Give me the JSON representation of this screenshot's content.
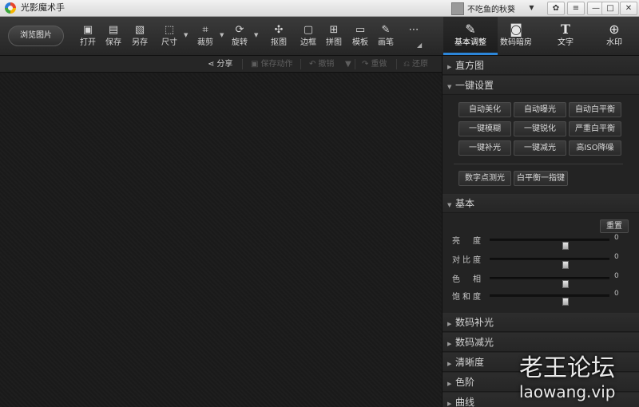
{
  "app": {
    "title": "光影魔术手"
  },
  "titlebar": {
    "user_name": "不吃鱼的秋葵",
    "buttons": [
      {
        "icon": "paw-icon",
        "glyph": "✿"
      },
      {
        "icon": "menu-icon",
        "glyph": "≡"
      },
      {
        "icon": "minimize-icon",
        "glyph": "—"
      },
      {
        "icon": "maximize-icon",
        "glyph": "□"
      },
      {
        "icon": "close-icon",
        "glyph": "✕"
      }
    ]
  },
  "toolbar": {
    "browse_label": "浏览图片",
    "tools": [
      {
        "label": "打开",
        "glyph": "▣"
      },
      {
        "label": "保存",
        "glyph": "▤"
      },
      {
        "label": "另存",
        "glyph": "▧"
      },
      {
        "label": "尺寸",
        "glyph": "⬚"
      },
      {
        "label": "裁剪",
        "glyph": "⌗"
      },
      {
        "label": "旋转",
        "glyph": "⟳"
      },
      {
        "label": "抠图",
        "glyph": "✣"
      },
      {
        "label": "边框",
        "glyph": "▢"
      },
      {
        "label": "拼图",
        "glyph": "⊞"
      },
      {
        "label": "模板",
        "glyph": "▭"
      },
      {
        "label": "画笔",
        "glyph": "✎"
      },
      {
        "label": "",
        "glyph": "⋯"
      }
    ],
    "modes": [
      {
        "label": "基本调整",
        "glyph": "✎",
        "active": true
      },
      {
        "label": "数码暗房",
        "glyph": "◙",
        "active": false
      },
      {
        "label": "文字",
        "glyph": "T",
        "active": false
      },
      {
        "label": "水印",
        "glyph": "⊕",
        "active": false
      }
    ]
  },
  "subbar": {
    "share": "分享",
    "save_action": "保存动作",
    "undo": "撤销",
    "redo": "重做",
    "restore": "还原"
  },
  "panel": {
    "histogram": "直方图",
    "one_click": "一键设置",
    "one_click_buttons": [
      "自动美化",
      "自动曝光",
      "自动白平衡",
      "一键模糊",
      "一键锐化",
      "严重白平衡",
      "一键补光",
      "一键减光",
      "高ISO降噪"
    ],
    "extra_buttons": [
      "数字点测光",
      "白平衡一指键"
    ],
    "basic": "基本",
    "reset": "重置",
    "sliders": [
      {
        "label": "亮　度",
        "value": "0",
        "position": 0.5
      },
      {
        "label": "对比度",
        "value": "0",
        "position": 0.5
      },
      {
        "label": "色　相",
        "value": "0",
        "position": 0.5
      },
      {
        "label": "饱和度",
        "value": "0",
        "position": 0.5
      }
    ],
    "collapsed_sections": [
      "数码补光",
      "数码减光",
      "清晰度",
      "色阶",
      "曲线"
    ]
  },
  "watermark": {
    "line1": "老王论坛",
    "line2": "laowang.vip"
  }
}
